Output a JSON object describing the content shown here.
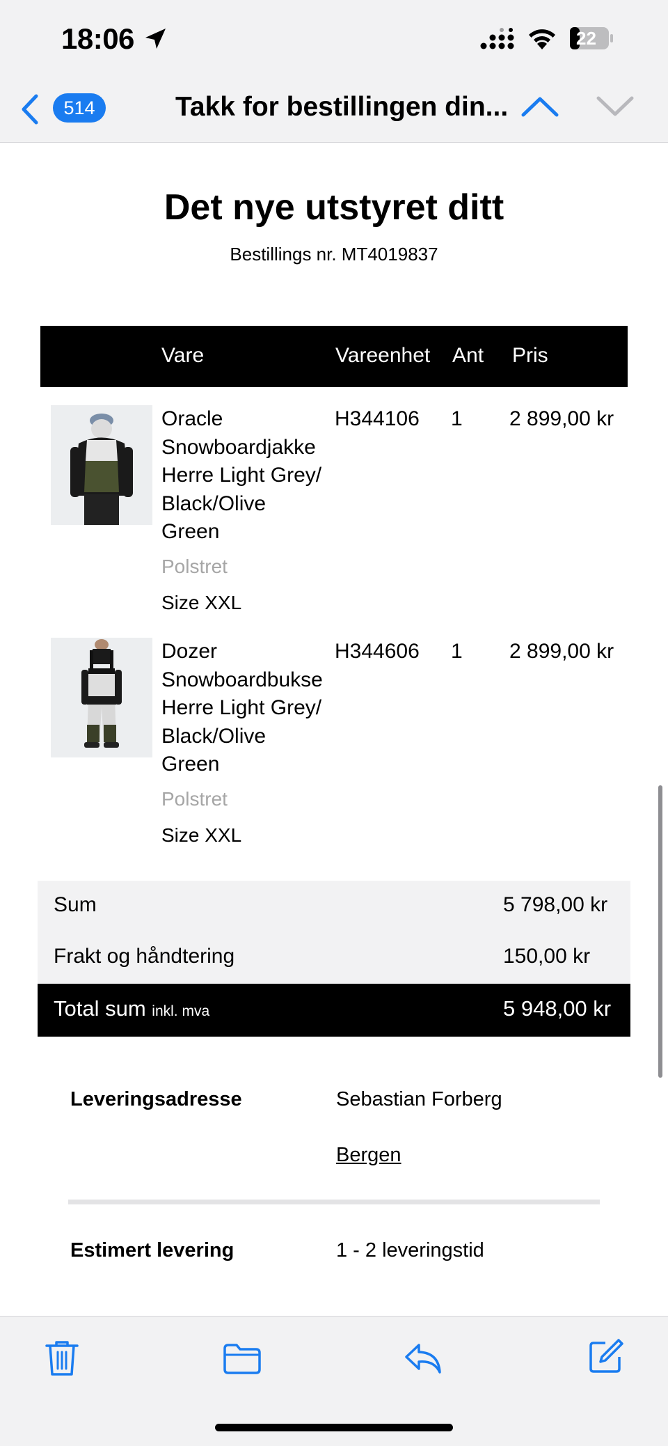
{
  "status_bar": {
    "time": "18:06",
    "battery_level": "22"
  },
  "nav": {
    "unread_count": "514",
    "title": "Takk for bestillingen din..."
  },
  "email": {
    "heading": "Det nye utstyret ditt",
    "order_number": "Bestillings nr. MT4019837",
    "table_headers": {
      "item": "Vare",
      "sku": "Vareenhet",
      "qty": "Ant",
      "price": "Pris"
    },
    "items": [
      {
        "name_lines": [
          "Oracle",
          "Snowboardjakke",
          "Herre Light Grey/",
          "Black/Olive",
          "Green"
        ],
        "variant": "Polstret",
        "size": "Size XXL",
        "sku": "H344106",
        "qty": "1",
        "price": "2 899,00 kr",
        "image_icon": "jacket-product-photo"
      },
      {
        "name_lines": [
          "Dozer",
          "Snowboardbukse",
          "Herre Light Grey/",
          "Black/Olive",
          "Green"
        ],
        "variant": "Polstret",
        "size": "Size XXL",
        "sku": "H344606",
        "qty": "1",
        "price": "2 899,00 kr",
        "image_icon": "pants-product-photo"
      }
    ],
    "summary": {
      "sum_label": "Sum",
      "sum_value": "5 798,00 kr",
      "shipping_label": "Frakt og håndtering",
      "shipping_value": "150,00 kr",
      "total_label": "Total sum",
      "total_sub": "inkl. mva",
      "total_value": "5 948,00 kr"
    },
    "delivery": {
      "address_label": "Leveringsadresse",
      "name": "Sebastian Forberg",
      "city": "Bergen",
      "estimate_label": "Estimert levering",
      "estimate_value": "1 - 2 leveringstid"
    }
  },
  "colors": {
    "accent": "#1a7cf0",
    "bar_background": "#f2f2f3",
    "table_header": "#000000",
    "muted_text": "#a6a6a6"
  }
}
